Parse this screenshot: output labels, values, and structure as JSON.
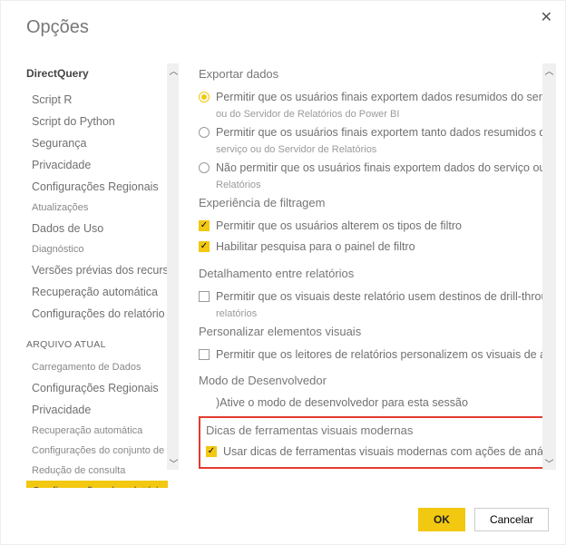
{
  "title": "Opções",
  "sidebar": {
    "group1_head": "DirectQuery",
    "group1": [
      "Script R",
      "Script do Python",
      "Segurança",
      "Privacidade",
      "Configurações Regionais",
      "Atualizações",
      "Dados de Uso",
      "Diagnóstico",
      "Versões prévias dos recursos",
      "Recuperação automática",
      "Configurações do relatório"
    ],
    "group2_head": "ARQUIVO ATUAL",
    "group2": [
      "Carregamento de Dados",
      "Configurações Regionais",
      "Privacidade",
      "Recuperação automática",
      "Configurações do conjunto de dados publicado",
      "Redução de consulta",
      "Configurações do relatório"
    ]
  },
  "content": {
    "export": {
      "head": "Exportar dados",
      "r1": "Permitir que os usuários finais exportem dados resumidos do serviço do P",
      "r1_sub": "ou do Servidor de Relatórios do Power BI",
      "r2": "Permitir que os usuários finais exportem tanto dados resumidos quanto sub",
      "r2_sub": "serviço ou do Servidor de Relatórios",
      "r3": "Não permitir que os usuários finais exportem dados do serviço ou do Servi",
      "r3_sub": "Relatórios"
    },
    "filter": {
      "head": "Experiência de filtragem",
      "c1": "Permitir que os usuários alterem os tipos de filtro",
      "c2": "Habilitar pesquisa para o painel de filtro"
    },
    "drill": {
      "head": "Detalhamento entre relatórios",
      "c1": "Permitir que os visuais deste relatório usem destinos de drill-through de ou",
      "c1_sub": "relatórios"
    },
    "pers": {
      "head": "Personalizar elementos visuais",
      "c1": "Permitir que os leitores de relatórios personalizem os visuais de acordo cor"
    },
    "dev": {
      "head": "Modo de Desenvolvedor",
      "text": ")Ative o modo de desenvolvedor para esta sessão"
    },
    "tooltip": {
      "head": "Dicas de ferramentas visuais modernas",
      "c1": "Usar dicas de ferramentas visuais modernas com ações de análise Vestio"
    }
  },
  "footer": {
    "ok": "OK",
    "cancel": "Cancelar"
  }
}
